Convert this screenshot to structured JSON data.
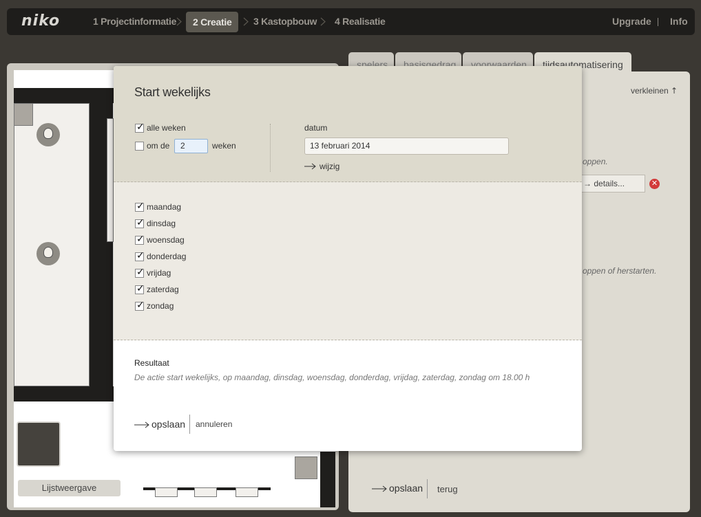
{
  "nav": {
    "logo": "niko",
    "steps": [
      "1 Projectinformatie",
      "2 Creatie",
      "3 Kastopbouw",
      "4 Realisatie"
    ],
    "active_step": 1,
    "upgrade": "Upgrade",
    "info": "Info"
  },
  "workspace": {
    "list_view_button": "Lijstweergave"
  },
  "panel": {
    "tabs": [
      "spelers",
      "basisgedrag",
      "voorwaarden",
      "tijdsautomatisering"
    ],
    "active_tab": 3,
    "collapse": "verkleinen",
    "text_stop": "oppen.",
    "text_restart": "oppen of herstarten.",
    "details": "details...",
    "save": "opslaan",
    "back": "terug"
  },
  "modal": {
    "title": "Start wekelijks",
    "all_weeks_label": "alle weken",
    "all_weeks_checked": true,
    "every_prefix": "om de",
    "every_checked": false,
    "every_value": "2",
    "every_suffix": "weken",
    "date_label": "datum",
    "date_value": "13 februari 2014",
    "change_link": "wijzig",
    "days": [
      {
        "label": "maandag",
        "checked": true
      },
      {
        "label": "dinsdag",
        "checked": true
      },
      {
        "label": "woensdag",
        "checked": true
      },
      {
        "label": "donderdag",
        "checked": true
      },
      {
        "label": "vrijdag",
        "checked": true
      },
      {
        "label": "zaterdag",
        "checked": true
      },
      {
        "label": "zondag",
        "checked": true
      }
    ],
    "result_title": "Resultaat",
    "result_text": "De actie start wekelijks,  op maandag, dinsdag, woensdag, donderdag, vrijdag, zaterdag, zondag om 18.00 h",
    "save": "opslaan",
    "cancel": "annuleren"
  }
}
